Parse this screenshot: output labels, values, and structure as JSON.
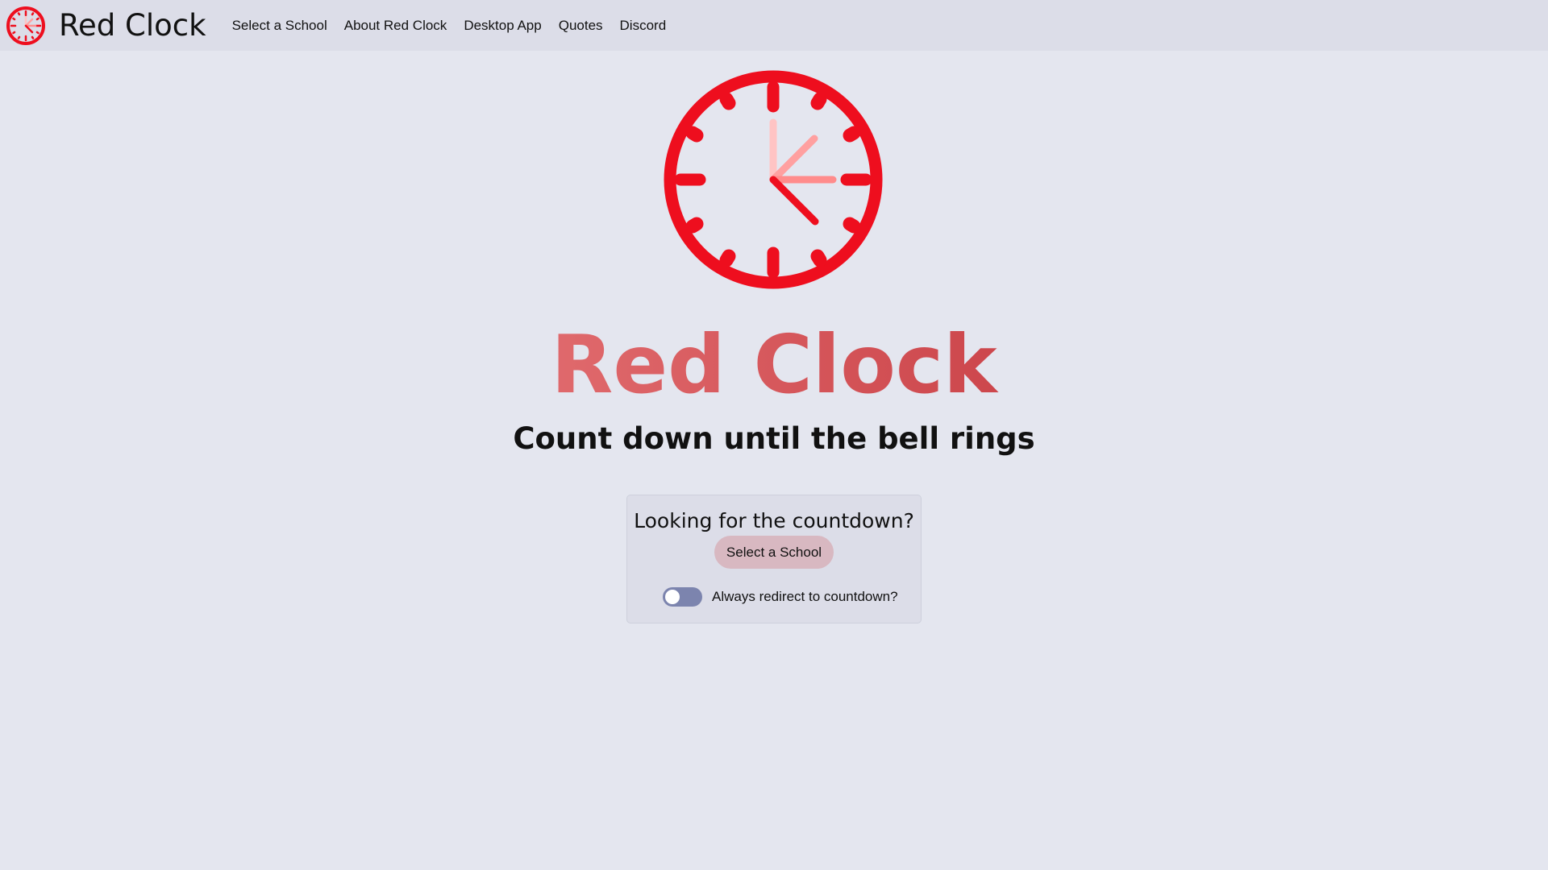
{
  "navbar": {
    "brand": "Red Clock",
    "logo_icon": "red-clock-logo-icon",
    "links": [
      {
        "label": "Select a School"
      },
      {
        "label": "About Red Clock"
      },
      {
        "label": "Desktop App"
      },
      {
        "label": "Quotes"
      },
      {
        "label": "Discord"
      }
    ]
  },
  "hero": {
    "clock_icon": "clock-icon",
    "title": "Red Clock",
    "subtitle": "Count down until the bell rings"
  },
  "card": {
    "title": "Looking for the countdown?",
    "button_label": "Select a School",
    "toggle_label": "Always redirect to countdown?",
    "toggle_on": false
  },
  "colors": {
    "accent_red": "#ee0e1e",
    "hand_pink": "#ffa0a0",
    "background": "#e4e6ef",
    "navbar": "#dcdde8",
    "button": "#d8b8c1",
    "toggle_track": "#7c84ae"
  }
}
